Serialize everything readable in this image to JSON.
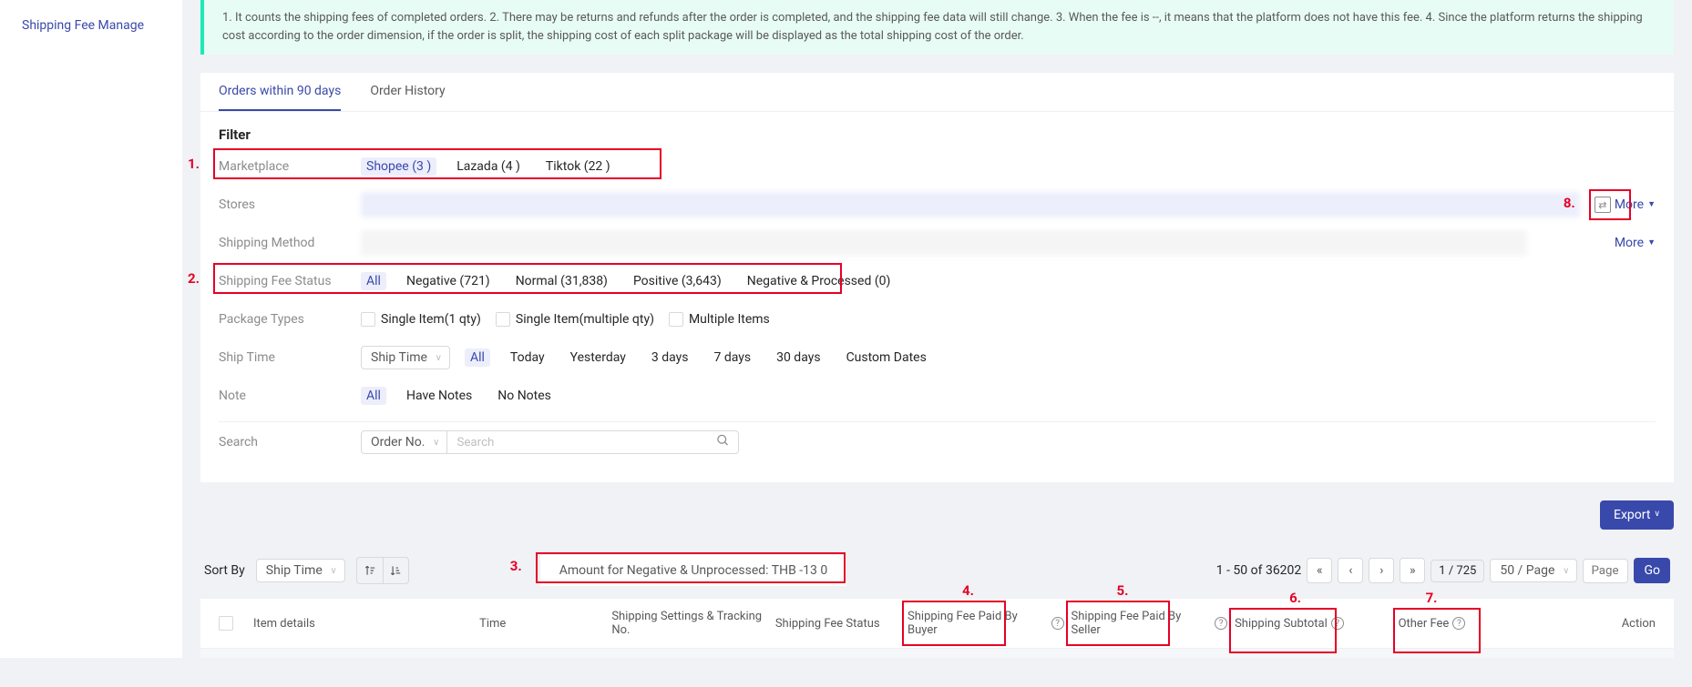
{
  "sidebar": {
    "link": "Shipping Fee Manage"
  },
  "notice": "1. It counts the shipping fees of completed orders. 2. There may be returns and refunds after the order is completed, and the shipping fee data will still change. 3. When the fee is --, it means that the platform does not have this fee. 4. Since the platform returns the shipping cost according to the order dimension, if the order is split, the shipping cost of each split package will be displayed as the total shipping cost of the order.",
  "tabs": {
    "t1": "Orders within 90 days",
    "t2": "Order History"
  },
  "filter": {
    "title": "Filter",
    "marketplace_label": "Marketplace",
    "marketplace": {
      "shopee": "Shopee (3       )",
      "lazada": "Lazada (4       )",
      "tiktok": "Tiktok (22      )"
    },
    "stores_label": "Stores",
    "shipmethod_label": "Shipping Method",
    "more": "More",
    "status_label": "Shipping Fee Status",
    "status": {
      "all": "All",
      "neg": "Negative (721)",
      "norm": "Normal (31,838)",
      "pos": "Positive (3,643)",
      "negp": "Negative & Processed (0)"
    },
    "pkg_label": "Package Types",
    "pkg": {
      "s1": "Single Item(1 qty)",
      "s2": "Single Item(multiple qty)",
      "s3": "Multiple Items"
    },
    "shiptime_label": "Ship Time",
    "shiptime_sel": "Ship Time",
    "shiptime": {
      "all": "All",
      "today": "Today",
      "yest": "Yesterday",
      "d3": "3 days",
      "d7": "7 days",
      "d30": "30 days",
      "custom": "Custom Dates"
    },
    "note_label": "Note",
    "note": {
      "all": "All",
      "have": "Have Notes",
      "no": "No Notes"
    },
    "search_label": "Search",
    "search_sel": "Order No.",
    "search_placeholder": "Search"
  },
  "toolbar": {
    "sort_by": "Sort By",
    "sort_sel": "Ship Time",
    "amount_line": "Amount for Negative & Unprocessed: THB -13        0",
    "range": "1 - 50 of 36202",
    "page_ind": "1 / 725",
    "page_size": "50 / Page",
    "page_jump_ph": "Page",
    "go": "Go",
    "export": "Export"
  },
  "thead": {
    "item": "Item details",
    "time": "Time",
    "settings": "Shipping Settings & Tracking No.",
    "status": "Shipping Fee Status",
    "paid_buyer": "Shipping Fee Paid By Buyer",
    "paid_seller": "Shipping Fee Paid By Seller",
    "subtotal": "Shipping Subtotal",
    "other": "Other Fee",
    "action": "Action"
  },
  "anno": {
    "n1": "1.",
    "n2": "2.",
    "n3": "3.",
    "n4": "4.",
    "n5": "5.",
    "n6": "6.",
    "n7": "7.",
    "n8": "8."
  }
}
